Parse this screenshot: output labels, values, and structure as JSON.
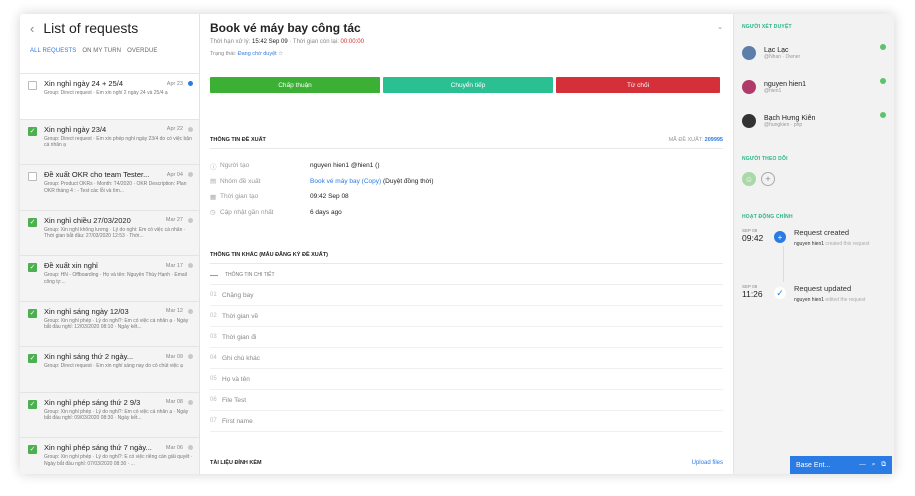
{
  "list": {
    "title": "List of requests",
    "tabs": [
      "ALL REQUESTS",
      "ON MY TURN",
      "OVERDUE"
    ],
    "items": [
      {
        "title": "Xin nghỉ ngày 24 + 25/4",
        "date": "Apr 23",
        "desc": "Group: Direct request · Em xin nghỉ 2 ngày 24 và 25/4 ạ",
        "checked": false,
        "unread": true
      },
      {
        "title": "Xin nghỉ ngày 23/4",
        "date": "Apr 22",
        "desc": "Group: Direct request · Em xin phép nghỉ ngày 23/4 do có việc bận cá nhân ạ",
        "checked": true,
        "unread": false
      },
      {
        "title": "Đề xuất OKR cho team Tester...",
        "date": "Apr 04",
        "desc": "Group: Product OKRs · Month: T4/2020 · OKR Description: Plan OKR tháng 4 : - Test các lỗi và tìm...",
        "checked": false,
        "unread": false
      },
      {
        "title": "Xin nghỉ chiều 27/03/2020",
        "date": "Mar 27",
        "desc": "Group: Xin nghỉ không lương · Lý do nghỉ: Em có việc cá nhân · Thời gian bắt đầu: 27/03/2020 12:53 · Thời...",
        "checked": true,
        "unread": false
      },
      {
        "title": "Đề xuất xin nghỉ",
        "date": "Mar 17",
        "desc": "Group: HN - Offboarding · Họ và tên: Nguyễn Thùy Hạnh · Email công ty:...",
        "checked": true,
        "unread": false
      },
      {
        "title": "Xin nghỉ sáng ngày 12/03",
        "date": "Mar 12",
        "desc": "Group: Xin nghỉ phép · Lý do nghỉ?: Em có việc cá nhân ạ · Ngày bắt đầu nghỉ: 12/03/2020 08:10 · Ngày kết...",
        "checked": true,
        "unread": false
      },
      {
        "title": "Xin nghỉ sáng thứ 2 ngày...",
        "date": "Mar 09",
        "desc": "Group: Direct request · Em xin nghỉ sáng nay do có chút việc ạ",
        "checked": true,
        "unread": false
      },
      {
        "title": "Xin nghỉ phép sáng thứ 2 9/3",
        "date": "Mar 08",
        "desc": "Group: Xin nghỉ phép · Lý do nghỉ?: Em có việc cá nhân ạ · Ngày bắt đầu nghỉ: 09/03/2020 08:30 · Ngày kết...",
        "checked": true,
        "unread": false
      },
      {
        "title": "Xin nghỉ phép sáng thứ 7 ngày...",
        "date": "Mar 06",
        "desc": "Group: Xin nghỉ phép · Lý do nghỉ?: E có việc riêng cần giải quyết · Ngày bắt đầu nghỉ: 07/03/2020 08:30 · ...",
        "checked": true,
        "unread": false
      }
    ]
  },
  "request": {
    "title": "Book vé máy bay công tác",
    "deadline_label": "Thời hạn xử lý:",
    "deadline_value": "15:42 Sep 09",
    "remaining_label": "· Thời gian còn lại:",
    "remaining_value": "00:00:00",
    "status_label": "Trạng thái:",
    "status_value": "Đang chờ duyệt",
    "star": "☆",
    "buttons": {
      "approve": "Chấp thuận",
      "forward": "Chuyển tiếp",
      "reject": "Từ chối"
    },
    "info_header": "THÔNG TIN ĐỀ XUẤT",
    "code_label": "MÃ ĐỀ XUẤT:",
    "code_value": "209995",
    "info": [
      {
        "icon": "ⓘ",
        "label": "Người tạo",
        "value": "nguyen hien1 @hien1 ()"
      },
      {
        "icon": "▤",
        "label": "Nhóm đề xuất",
        "value": "Book vé máy bay (Copy)",
        "extra": " (Duyệt đồng thời)"
      },
      {
        "icon": "▦",
        "label": "Thời gian tạo",
        "value": "09:42 Sep 08"
      },
      {
        "icon": "◷",
        "label": "Cập nhật gần nhất",
        "value": "6 days ago"
      }
    ],
    "other_header": "THÔNG TIN KHÁC (MẪU ĐĂNG KÝ ĐỀ XUẤT)",
    "detail_header": "THÔNG TIN CHI TIẾT",
    "fields": [
      {
        "num": "01",
        "label": "Chặng bay"
      },
      {
        "num": "02",
        "label": "Thời gian về"
      },
      {
        "num": "03",
        "label": "Thời gian đi"
      },
      {
        "num": "04",
        "label": "Ghi chú khác"
      },
      {
        "num": "05",
        "label": "Họ và tên"
      },
      {
        "num": "06",
        "label": "File Test"
      },
      {
        "num": "07",
        "label": "First name"
      }
    ],
    "attach_header": "TÀI LIỆU ĐÍNH KÈM",
    "upload_label": "Upload files"
  },
  "sidebar": {
    "approvers_header": "NGƯỜI XÉT DUYỆT",
    "approvers": [
      {
        "name": "Lạc Lạc",
        "sub": "@Nhan · Owner",
        "color": "#5b7fa8"
      },
      {
        "name": "nguyen hien1",
        "sub": "@hien1",
        "color": "#b03a6a"
      },
      {
        "name": "Bạch Hưng Kiên",
        "sub": "@hungkien · php",
        "color": "#333333"
      }
    ],
    "followers_header": "NGƯỜI THEO DÕI",
    "activity_header": "HOẠT ĐỘNG CHÍNH",
    "activities": [
      {
        "month": "SEP 08",
        "time": "09:42",
        "title": "Request created",
        "by": "nguyen hien1",
        "action": "created this request",
        "icon": "+"
      },
      {
        "month": "SEP 08",
        "time": "11:26",
        "title": "Request updated",
        "by": "nguyen hien1",
        "action": "edited the request",
        "icon": "✓"
      }
    ],
    "chat_label": "Base Ent..."
  }
}
